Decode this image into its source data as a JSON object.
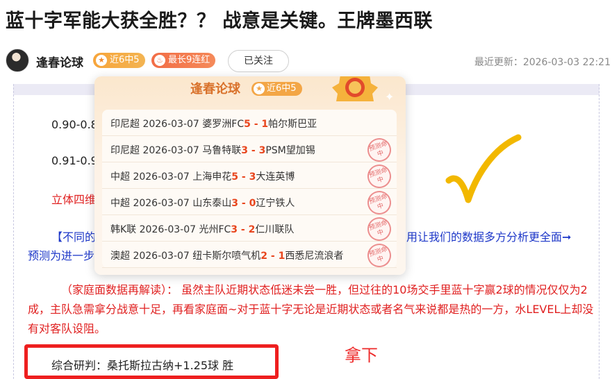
{
  "article": {
    "title": "蓝十字军能大获全胜？？ 战意是关键。王牌墨西联"
  },
  "author": {
    "name": "逢春论球",
    "badge_recent": "近6中5",
    "badge_streak": "最长9连红",
    "follow_label": "已关注",
    "update_label": "最近更新：",
    "update_time": "2026-03-03 22:21"
  },
  "body": {
    "odds_line_1": "0.90-0.8",
    "odds_line_2": "0.91-0.9",
    "red_line": "立体四维",
    "blue_left": "【不同的",
    "blue_right": "用让我们的数据多方分析更全面➞",
    "blue_line_2": "预测为进一步",
    "analysis": "（家庭面数据再解读）： 虽然主队近期状态低迷未尝一胜，但过往的10场交手里蓝十字赢2球的情况仅仅为2成，主队急需拿分战意十足，再看家庭面~对于蓝十字无论是近期状态或者名气来说都是热的一方，水LEVEL上却没有对客队设阻。",
    "verdict": "综合研判：桑托斯拉古纳+1.25球  胜",
    "annotation": "拿下"
  },
  "popup": {
    "name": "逢春论球",
    "badge": "近6中5",
    "matches": [
      {
        "league": "印尼超",
        "date": "2026-03-07",
        "home": "婆罗洲FC",
        "home_score": "5",
        "sep": " - ",
        "away_score": "1",
        "away": "帕尔斯巴亚",
        "stamp": ""
      },
      {
        "league": "印尼超",
        "date": "2026-03-07",
        "home": "马鲁特联",
        "home_score": "3",
        "sep": " - ",
        "away_score": "3",
        "away": "PSM望加锡",
        "stamp": "预测命中"
      },
      {
        "league": "中超",
        "date": "2026-03-07",
        "home": "上海申花",
        "home_score": "5",
        "sep": " - ",
        "away_score": "3",
        "away": "大连英博",
        "stamp": "预测命中"
      },
      {
        "league": "中超",
        "date": "2026-03-07",
        "home": "山东泰山",
        "home_score": "3",
        "sep": " - ",
        "away_score": "0",
        "away": "辽宁铁人",
        "stamp": "预测命中"
      },
      {
        "league": "韩K联",
        "date": "2026-03-07",
        "home": "光州FC",
        "home_score": "3",
        "sep": " - ",
        "away_score": "2",
        "away": "仁川联队",
        "stamp": "预测命中"
      },
      {
        "league": "澳超",
        "date": "2026-03-07",
        "home": "纽卡斯尔喷气机",
        "home_score": "2",
        "sep": " - ",
        "away_score": "1",
        "away": "西悉尼流浪者",
        "stamp": "预测命中"
      }
    ]
  },
  "colors": {
    "score": "#e8461e",
    "analysis_text": "#e02020",
    "blue_text": "#1d37c8",
    "check_mark": "#f2b800",
    "verdict_border": "#ee1f1f"
  },
  "icons": {
    "badge_recent": "star-icon",
    "badge_streak": "flame-icon",
    "popup_medal": "medal-icon",
    "check": "check-mark-icon"
  }
}
